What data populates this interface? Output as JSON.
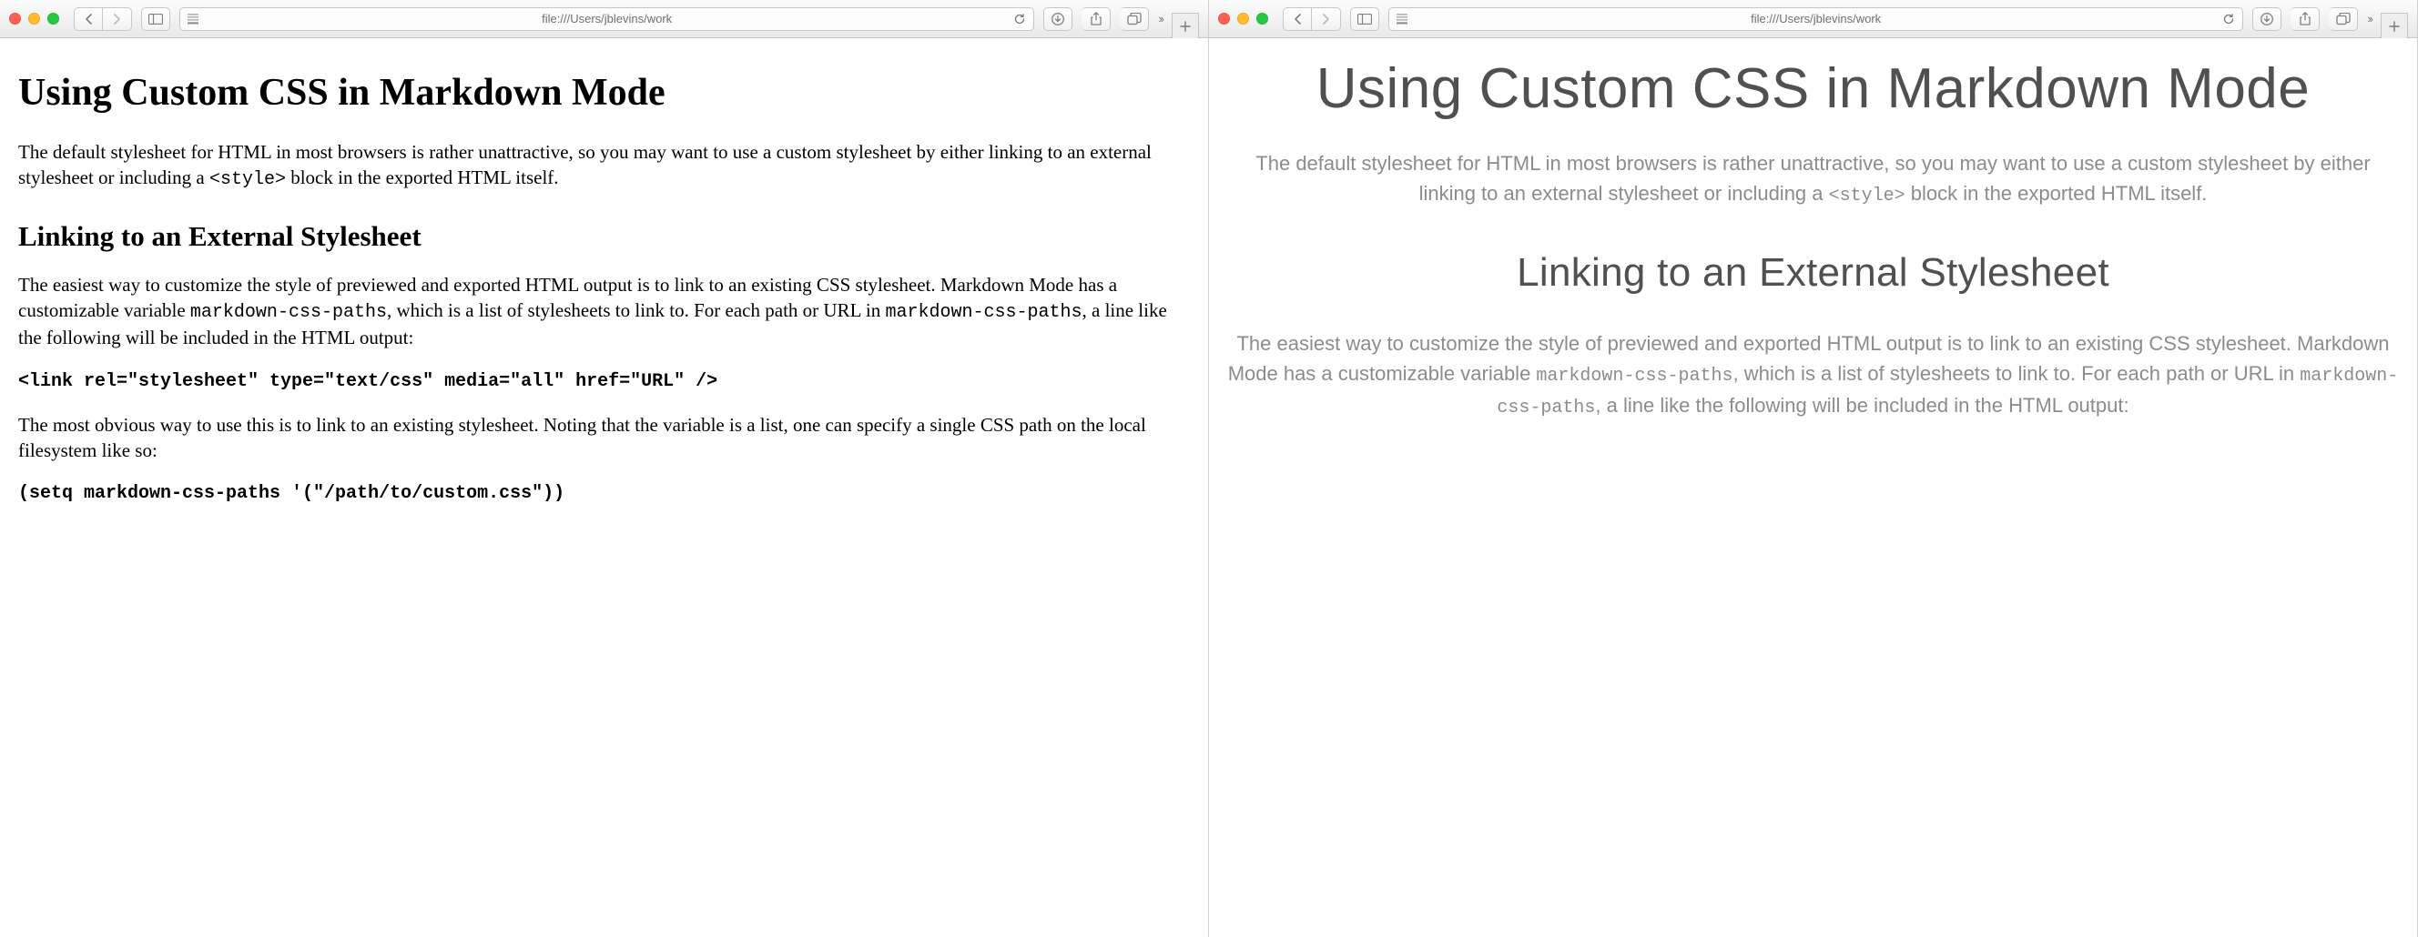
{
  "toolbar": {
    "url": "file:///Users/jblevins/work"
  },
  "doc": {
    "h1": "Using Custom CSS in Markdown Mode",
    "p1_a": "The default stylesheet for HTML in most browsers is rather unattractive, so you may want to use a custom stylesheet by either linking to an external stylesheet or including a ",
    "p1_code": "<style>",
    "p1_b": " block in the exported HTML itself.",
    "h2": "Linking to an External Stylesheet",
    "p2_a": "The easiest way to customize the style of previewed and exported HTML output is to link to an existing CSS stylesheet. Markdown Mode has a customizable variable ",
    "p2_code1": "markdown-css-paths",
    "p2_b": ", which is a list of stylesheets to link to. For each path or URL in ",
    "p2_code2": "markdown-css-paths",
    "p2_c": ", a line like the following will be included in the HTML output:",
    "pre1": "<link rel=\"stylesheet\" type=\"text/css\" media=\"all\" href=\"URL\" />",
    "p3": "The most obvious way to use this is to link to an existing stylesheet. Noting that the variable is a list, one can specify a single CSS path on the local filesystem like so:",
    "pre2": "(setq markdown-css-paths '(\"/path/to/custom.css\"))"
  }
}
